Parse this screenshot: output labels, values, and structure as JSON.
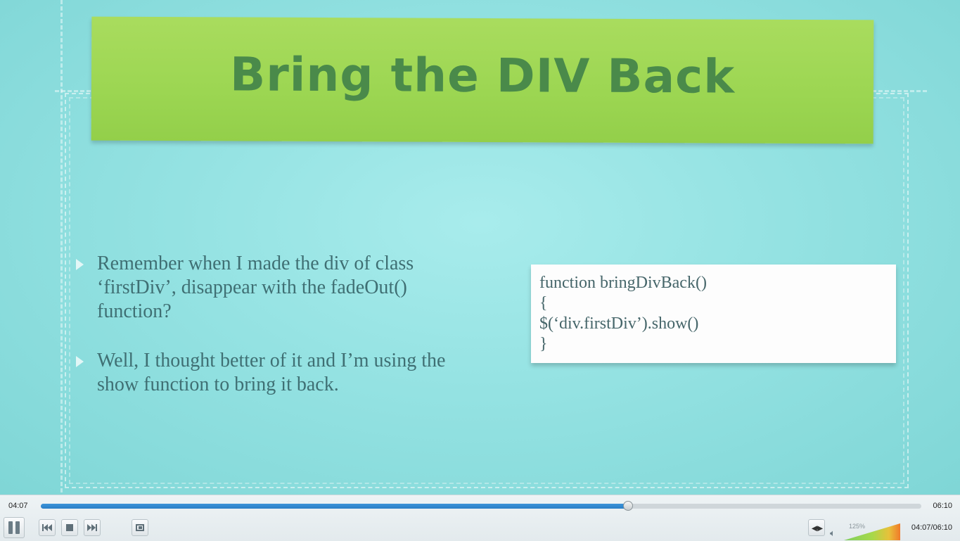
{
  "slide": {
    "title": "Bring the DIV Back",
    "bullets": [
      "Remember when I made the div of class\n‘firstDiv’, disappear with the fadeOut()\nfunction?",
      "Well, I thought better of it and I’m using the\nshow function to bring it back."
    ],
    "code_lines": [
      "function bringDivBack()",
      "{",
      "$(‘div.firstDiv’).show()",
      "}"
    ]
  },
  "player": {
    "elapsed": "04:07",
    "total": "06:10",
    "progress": 0.667,
    "volume_label": "125%",
    "volume_level": 1.0,
    "time_combo": "04:07/06:10",
    "icons": {
      "pause": "pause-icon",
      "prev": "previous-icon",
      "stop": "stop-icon",
      "next": "next-icon",
      "fullscreen": "fullscreen-icon",
      "extended": "extended-settings-icon",
      "speaker": "speaker-icon"
    }
  }
}
